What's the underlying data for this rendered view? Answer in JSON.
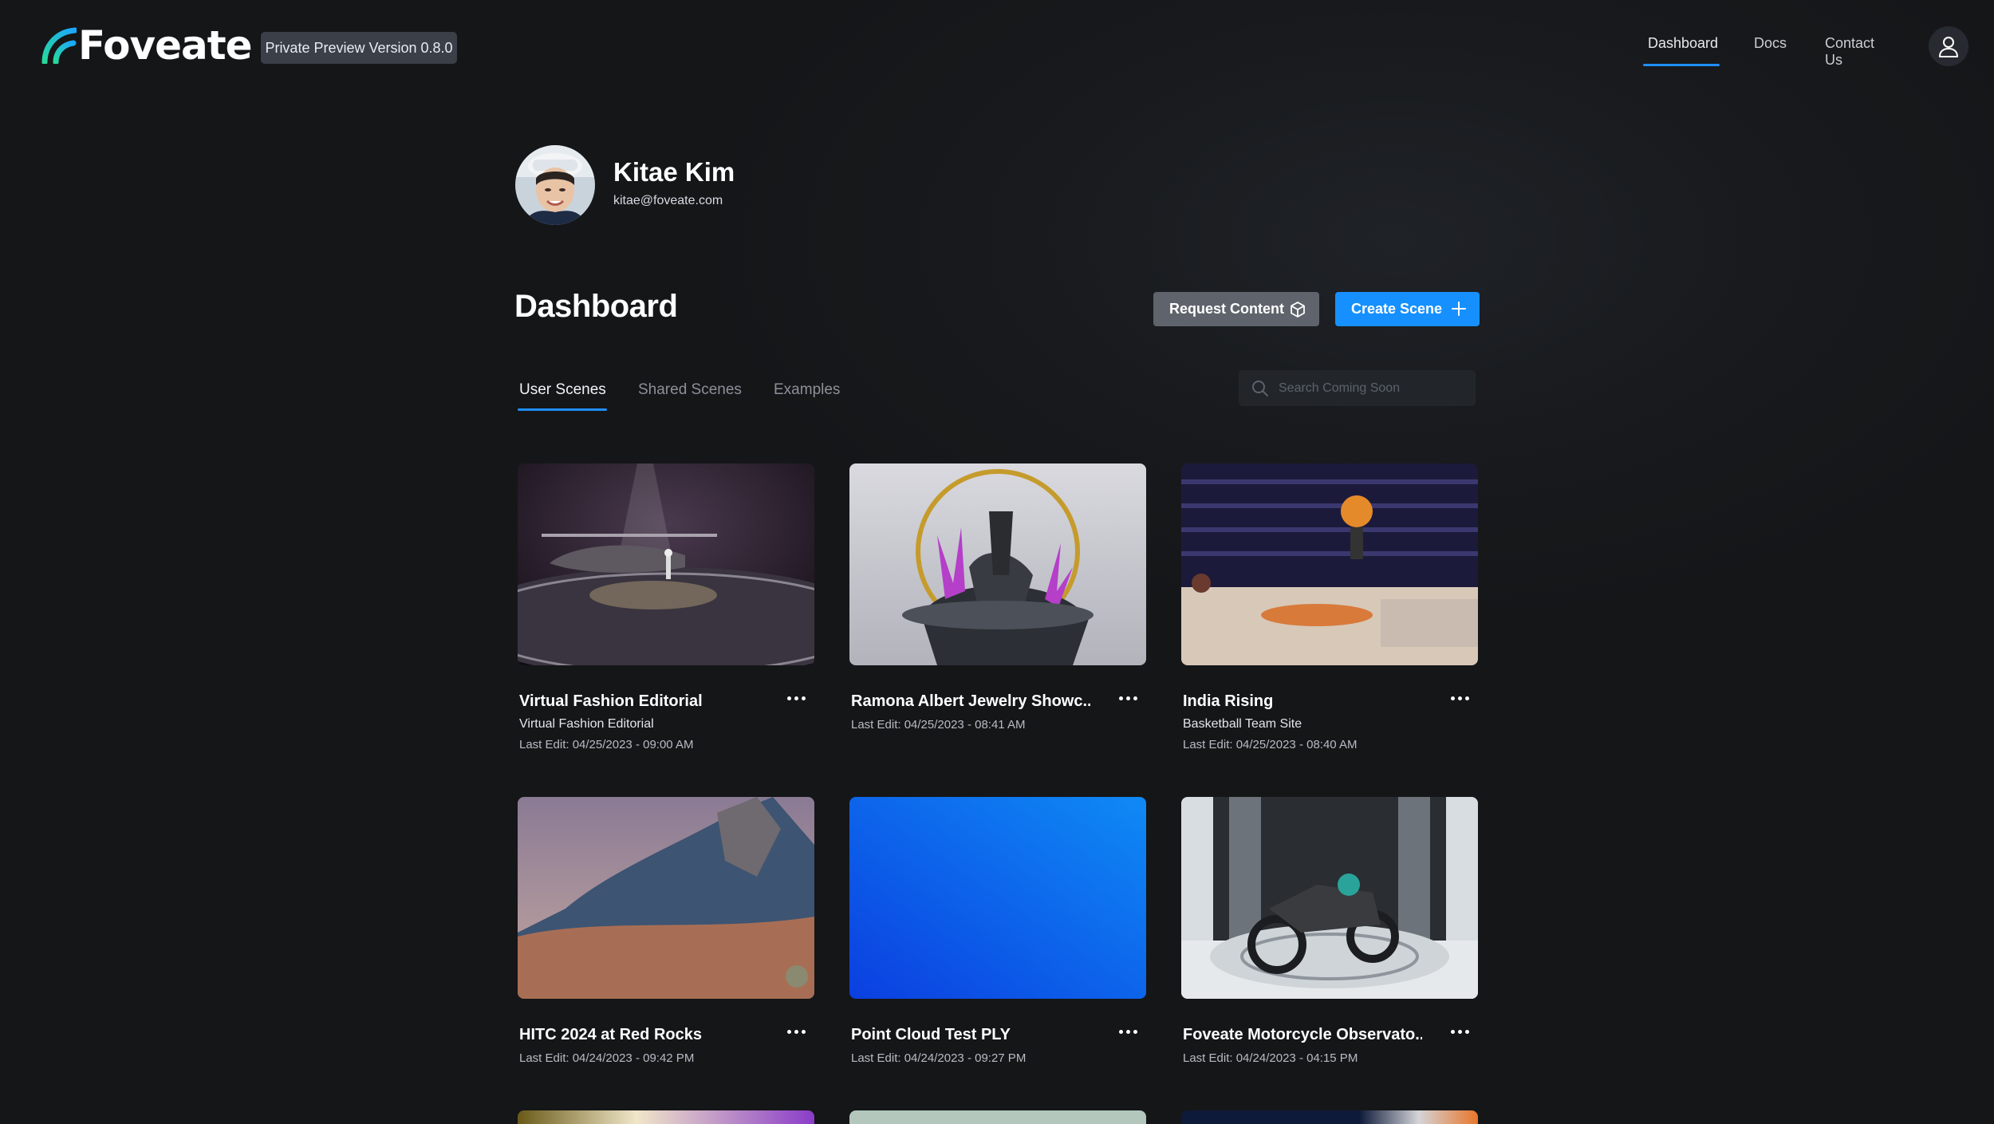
{
  "brand": {
    "name": "Foveate",
    "version_badge": "Private Preview Version 0.8.0"
  },
  "nav": {
    "items": [
      "Dashboard",
      "Docs",
      "Contact Us"
    ],
    "active": "Dashboard"
  },
  "user": {
    "name": "Kitae Kim",
    "email": "kitae@foveate.com"
  },
  "page": {
    "title": "Dashboard"
  },
  "actions": {
    "request_label": "Request Content",
    "create_label": "Create Scene"
  },
  "tabs": [
    {
      "label": "User Scenes",
      "active": true
    },
    {
      "label": "Shared Scenes",
      "active": false
    },
    {
      "label": "Examples",
      "active": false
    }
  ],
  "search": {
    "placeholder": "Search Coming Soon"
  },
  "scenes": [
    {
      "title": "Virtual Fashion Editorial",
      "subtitle": "Virtual Fashion Editorial",
      "last_edit": "Last Edit: 04/25/2023 - 09:00 AM"
    },
    {
      "title": "Ramona Albert Jewelry Showc...",
      "subtitle": "",
      "last_edit": "Last Edit: 04/25/2023 - 08:41 AM"
    },
    {
      "title": "India Rising",
      "subtitle": "Basketball Team Site",
      "last_edit": "Last Edit: 04/25/2023 - 08:40 AM"
    },
    {
      "title": "HITC 2024 at Red Rocks",
      "subtitle": "",
      "last_edit": "Last Edit: 04/24/2023 - 09:42 PM"
    },
    {
      "title": "Point Cloud Test PLY",
      "subtitle": "",
      "last_edit": "Last Edit: 04/24/2023 - 09:27 PM"
    },
    {
      "title": "Foveate Motorcycle Observato...",
      "subtitle": "",
      "last_edit": "Last Edit: 04/24/2023 - 04:15 PM"
    }
  ],
  "colors": {
    "accent": "#1690ff",
    "background": "#17191c",
    "badge": "#3a3f48",
    "secondary_button": "#5f646c"
  }
}
